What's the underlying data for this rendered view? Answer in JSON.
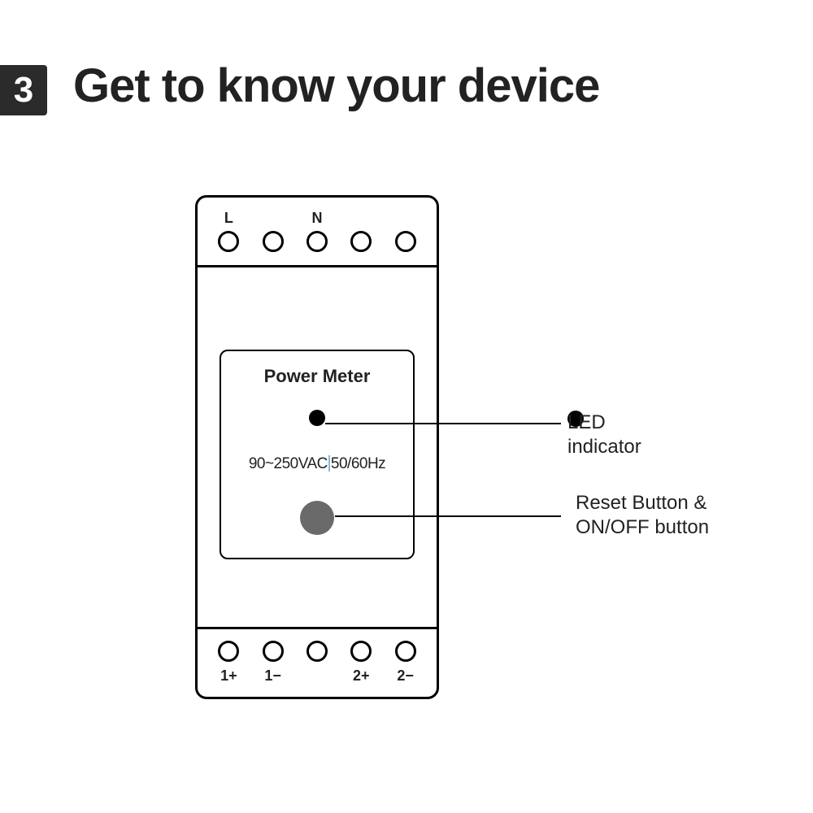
{
  "step_number": "3",
  "title": "Get to know your device",
  "device": {
    "face_title": "Power Meter",
    "spec_left": "90~250VAC",
    "spec_right": "50/60Hz",
    "top_terminals": {
      "labels": [
        "L",
        "",
        "N",
        "",
        ""
      ]
    },
    "bottom_terminals": {
      "labels": [
        "1+",
        "1−",
        "",
        "2+",
        "2−"
      ]
    }
  },
  "callouts": {
    "led": "LED indicator",
    "reset_line1": "Reset Button &",
    "reset_line2": "ON/OFF button"
  }
}
